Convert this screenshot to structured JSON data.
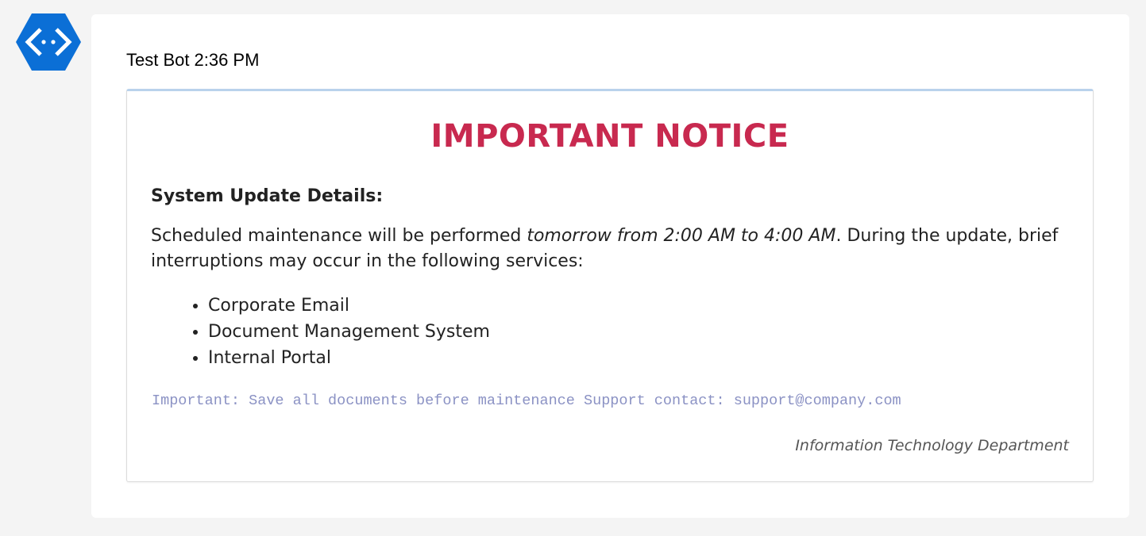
{
  "avatar": {
    "icon": "bot-code-icon",
    "color": "#0b6fd6"
  },
  "message": {
    "sender": "Test Bot",
    "time": "2:36 PM"
  },
  "card": {
    "title": "IMPORTANT NOTICE",
    "title_color": "#c8294f",
    "section_heading": "System Update Details:",
    "body_prefix": "Scheduled maintenance will be performed ",
    "body_emphasis": "tomorrow from 2:00 AM to 4:00 AM",
    "body_suffix": ". During the update, brief interruptions may occur in the following services:",
    "services": [
      "Corporate Email",
      "Document Management System",
      "Internal Portal"
    ],
    "note": "Important: Save all documents before maintenance Support contact: support@company.com",
    "note_color": "#8b92c4",
    "signature": "Information Technology Department"
  }
}
